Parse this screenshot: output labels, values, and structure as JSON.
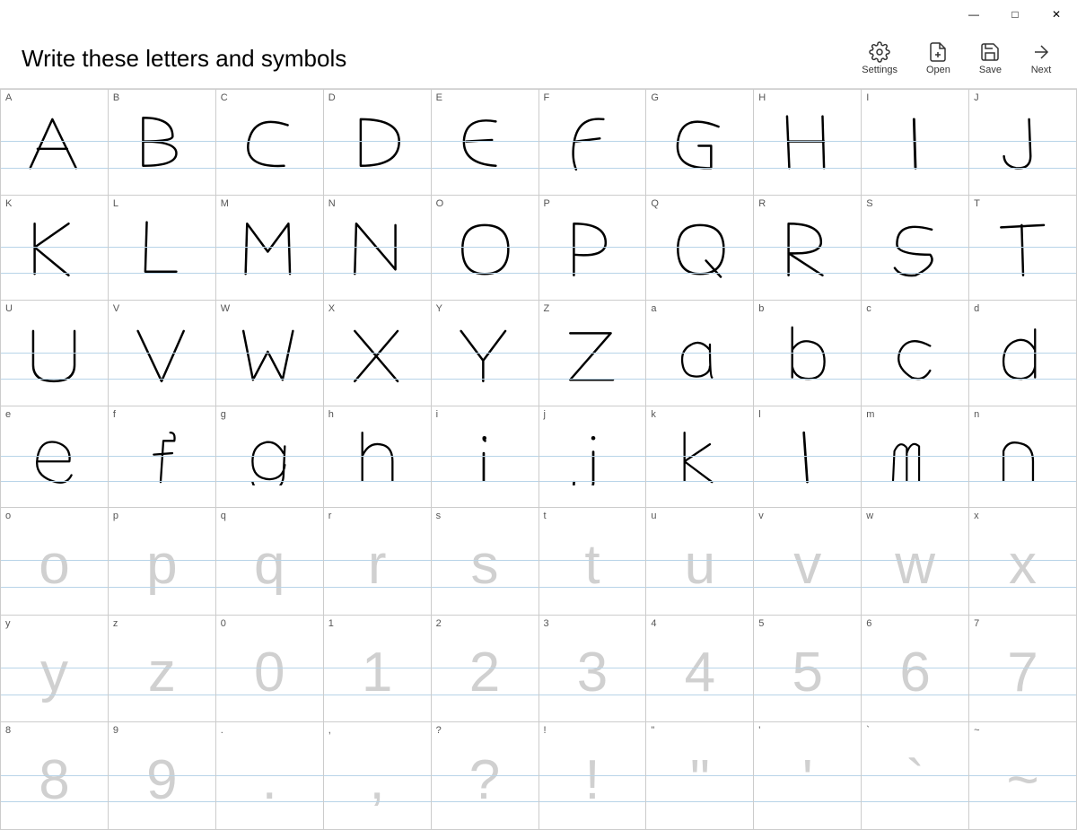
{
  "window": {
    "title": "Write these letters and symbols"
  },
  "titlebar": {
    "minimize": "—",
    "maximize": "□",
    "close": "✕"
  },
  "toolbar": {
    "settings_label": "Settings",
    "open_label": "Open",
    "save_label": "Save",
    "next_label": "Next"
  },
  "cells": [
    {
      "label": "A",
      "drawn": true,
      "char": "A"
    },
    {
      "label": "B",
      "drawn": true,
      "char": "B"
    },
    {
      "label": "C",
      "drawn": true,
      "char": "C"
    },
    {
      "label": "D",
      "drawn": true,
      "char": "D"
    },
    {
      "label": "E",
      "drawn": true,
      "char": "E"
    },
    {
      "label": "F",
      "drawn": true,
      "char": "F"
    },
    {
      "label": "G",
      "drawn": true,
      "char": "G"
    },
    {
      "label": "H",
      "drawn": true,
      "char": "H"
    },
    {
      "label": "I",
      "drawn": true,
      "char": "I"
    },
    {
      "label": "J",
      "drawn": true,
      "char": "J"
    },
    {
      "label": "K",
      "drawn": true,
      "char": "K"
    },
    {
      "label": "L",
      "drawn": true,
      "char": "L"
    },
    {
      "label": "M",
      "drawn": true,
      "char": "M"
    },
    {
      "label": "N",
      "drawn": true,
      "char": "N"
    },
    {
      "label": "O",
      "drawn": true,
      "char": "O"
    },
    {
      "label": "P",
      "drawn": true,
      "char": "P"
    },
    {
      "label": "Q",
      "drawn": true,
      "char": "Q"
    },
    {
      "label": "R",
      "drawn": true,
      "char": "R"
    },
    {
      "label": "S",
      "drawn": true,
      "char": "S"
    },
    {
      "label": "T",
      "drawn": true,
      "char": "T"
    },
    {
      "label": "U",
      "drawn": true,
      "char": "U"
    },
    {
      "label": "V",
      "drawn": true,
      "char": "V"
    },
    {
      "label": "W",
      "drawn": true,
      "char": "W"
    },
    {
      "label": "X",
      "drawn": true,
      "char": "X"
    },
    {
      "label": "Y",
      "drawn": true,
      "char": "Y"
    },
    {
      "label": "Z",
      "drawn": true,
      "char": "Z"
    },
    {
      "label": "a",
      "drawn": true,
      "char": "a"
    },
    {
      "label": "b",
      "drawn": true,
      "char": "b"
    },
    {
      "label": "c",
      "drawn": true,
      "char": "c"
    },
    {
      "label": "d",
      "drawn": true,
      "char": "d"
    },
    {
      "label": "e",
      "drawn": true,
      "char": "e"
    },
    {
      "label": "f",
      "drawn": true,
      "char": "f"
    },
    {
      "label": "g",
      "drawn": true,
      "char": "g"
    },
    {
      "label": "h",
      "drawn": true,
      "char": "h"
    },
    {
      "label": "i",
      "drawn": true,
      "char": "i"
    },
    {
      "label": "j",
      "drawn": true,
      "char": "j"
    },
    {
      "label": "k",
      "drawn": true,
      "char": "k"
    },
    {
      "label": "l",
      "drawn": true,
      "char": "l"
    },
    {
      "label": "m",
      "drawn": true,
      "char": "m"
    },
    {
      "label": "n",
      "drawn": true,
      "char": "n"
    },
    {
      "label": "o",
      "drawn": false,
      "char": "o"
    },
    {
      "label": "p",
      "drawn": false,
      "char": "p"
    },
    {
      "label": "q",
      "drawn": false,
      "char": "q"
    },
    {
      "label": "r",
      "drawn": false,
      "char": "r"
    },
    {
      "label": "s",
      "drawn": false,
      "char": "s"
    },
    {
      "label": "t",
      "drawn": false,
      "char": "t"
    },
    {
      "label": "u",
      "drawn": false,
      "char": "u"
    },
    {
      "label": "v",
      "drawn": false,
      "char": "v"
    },
    {
      "label": "w",
      "drawn": false,
      "char": "w"
    },
    {
      "label": "x",
      "drawn": false,
      "char": "x"
    },
    {
      "label": "y",
      "drawn": false,
      "char": "y"
    },
    {
      "label": "z",
      "drawn": false,
      "char": "z"
    },
    {
      "label": "0",
      "drawn": false,
      "char": "0"
    },
    {
      "label": "1",
      "drawn": false,
      "char": "1"
    },
    {
      "label": "2",
      "drawn": false,
      "char": "2"
    },
    {
      "label": "3",
      "drawn": false,
      "char": "3"
    },
    {
      "label": "4",
      "drawn": false,
      "char": "4"
    },
    {
      "label": "5",
      "drawn": false,
      "char": "5"
    },
    {
      "label": "6",
      "drawn": false,
      "char": "6"
    },
    {
      "label": "7",
      "drawn": false,
      "char": "7"
    },
    {
      "label": "8",
      "drawn": false,
      "char": "8"
    },
    {
      "label": "9",
      "drawn": false,
      "char": "9"
    },
    {
      "label": ".",
      "drawn": false,
      "char": "."
    },
    {
      "label": ",",
      "drawn": false,
      "char": ","
    },
    {
      "label": "?",
      "drawn": false,
      "char": "?"
    },
    {
      "label": "!",
      "drawn": false,
      "char": "!"
    },
    {
      "label": "\"",
      "drawn": false,
      "char": "\""
    },
    {
      "label": "'",
      "drawn": false,
      "char": "'"
    },
    {
      "label": "`",
      "drawn": false,
      "char": "`"
    },
    {
      "label": "~",
      "drawn": false,
      "char": "~"
    }
  ]
}
